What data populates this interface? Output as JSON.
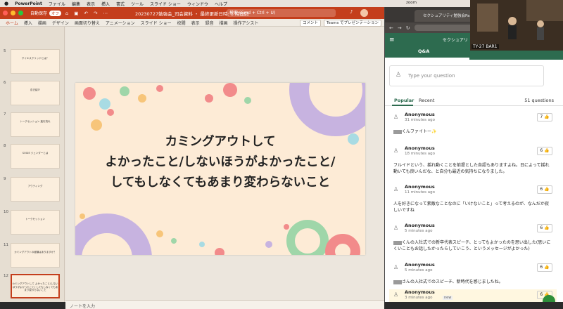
{
  "menubar": {
    "apple": "",
    "items": [
      "PowerPoint",
      "ファイル",
      "編集",
      "表示",
      "挿入",
      "書式",
      "ツール",
      "スライド ショー",
      "ウィンドウ",
      "ヘルプ"
    ],
    "zoom": "zoom"
  },
  "ppt": {
    "autosave_label": "自動保存",
    "autosave_toggle": "オフ",
    "file_title": "20230727勉強会_司会資料 ・ 最終更新日時: 1 時間前",
    "search_placeholder": "検索 (Cmd + Ctrl + U)",
    "ribbon_tabs": [
      "ホーム",
      "挿入",
      "描画",
      "デザイン",
      "画面切り替え",
      "アニメーション",
      "スライド ショー",
      "校閲",
      "表示",
      "録音",
      "描画",
      "操作アシスト"
    ],
    "comment_btn": "コメント",
    "teams_btn": "Teams でプレゼンテーション",
    "thumbnails": [
      {
        "num": "5",
        "text": "サイエスクリッドとは？"
      },
      {
        "num": "6",
        "text": "自己紹介"
      },
      {
        "num": "7",
        "text": "トークセッション 進行流れ"
      },
      {
        "num": "8",
        "text": "SOGIE ジェンダーとは"
      },
      {
        "num": "9",
        "text": "アウティング"
      },
      {
        "num": "10",
        "text": "トークセッション"
      },
      {
        "num": "11",
        "text": "カミングアウトの経験はありますか？"
      },
      {
        "num": "12",
        "text": "カミングアウトして よかったこと/しないほうがよかったこと/ してもしなくてもあまり変わらないこと"
      }
    ],
    "slide_lines": [
      "カミングアウトして",
      "よかったこと/しないほうがよかったこと/",
      "してもしなくてもあまり変わらないこと"
    ],
    "notes_placeholder": "ノートを入力"
  },
  "browser": {
    "tab_title": "セクシュアリティ勉強会Part2",
    "zoom_label": "zoom"
  },
  "slido": {
    "event_title": "セクシュアリ",
    "tab_qa": "Q&A",
    "input_placeholder": "Type your question",
    "tab_popular": "Popular",
    "tab_recent": "Recent",
    "count": "51 questions",
    "questions": [
      {
        "name": "Anonymous",
        "time": "31 minutes ago",
        "likes": "7",
        "text": "くんファイトー✨"
      },
      {
        "name": "Anonymous",
        "time": "18 minutes ago",
        "likes": "6",
        "text": "フルイドという、揺れ動くことを前提とした自認もありますよね。日によって揺れ動いても良いんだな、と自分も最近の気持ちになりました。"
      },
      {
        "name": "Anonymous",
        "time": "11 minutes ago",
        "likes": "6",
        "text": "人を好きになって素敵なことなのに「いけないこと」って考えるのが、なんだか寂しいですね"
      },
      {
        "name": "Anonymous",
        "time": "5 minutes ago",
        "likes": "6",
        "text": "くんの入社式での新卒代表スピーチ、とってもよかったのを思い出した(思いにくいこともお話したかったらしていこう、というメッセージがよかった)"
      },
      {
        "name": "Anonymous",
        "time": "5 minutes ago",
        "likes": "6",
        "text": "さんの入社式でのスピーチ、新時代を感じましたね。"
      },
      {
        "name": "Anonymous",
        "time": "3 minutes ago",
        "likes": "6",
        "text": "",
        "tag": "new"
      }
    ]
  },
  "video": {
    "label": "TY-27 BAR1"
  }
}
